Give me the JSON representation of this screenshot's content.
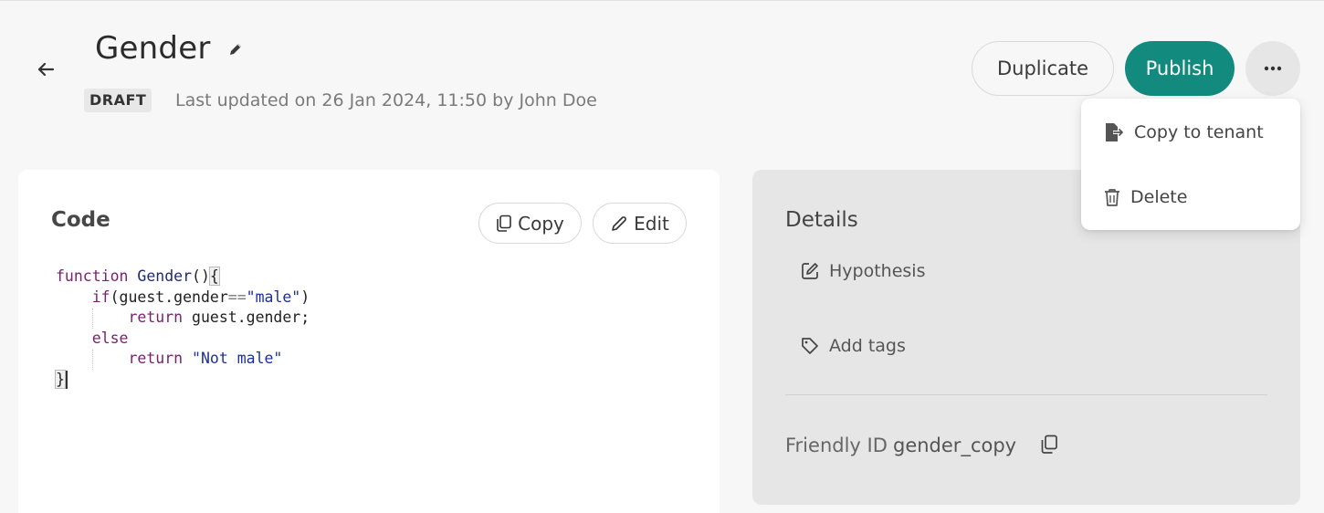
{
  "header": {
    "title": "Gender",
    "status": "DRAFT",
    "last_updated": "Last updated on 26 Jan 2024, 11:50 by John Doe",
    "duplicate_label": "Duplicate",
    "publish_label": "Publish",
    "icons": {
      "back": "arrow-left-icon",
      "edit_title": "pencil-icon",
      "more": "ellipsis-icon"
    }
  },
  "menu": {
    "items": [
      {
        "label": "Copy to tenant",
        "icon": "file-export-icon"
      },
      {
        "label": "Delete",
        "icon": "trash-icon"
      }
    ]
  },
  "code_card": {
    "title": "Code",
    "copy_label": "Copy",
    "edit_label": "Edit",
    "lines": [
      "function Gender(){",
      "    if(guest.gender==\"male\")",
      "        return guest.gender;",
      "    else",
      "        return \"Not male\"",
      "}"
    ]
  },
  "details_card": {
    "title": "Details",
    "hypothesis_label": "Hypothesis",
    "add_tags_label": "Add tags",
    "friendly_id_label": "Friendly ID",
    "friendly_id_value": "gender_copy"
  },
  "colors": {
    "primary": "#128a7e",
    "page_bg": "#f7f7f7",
    "details_bg": "#e6e6e6"
  }
}
